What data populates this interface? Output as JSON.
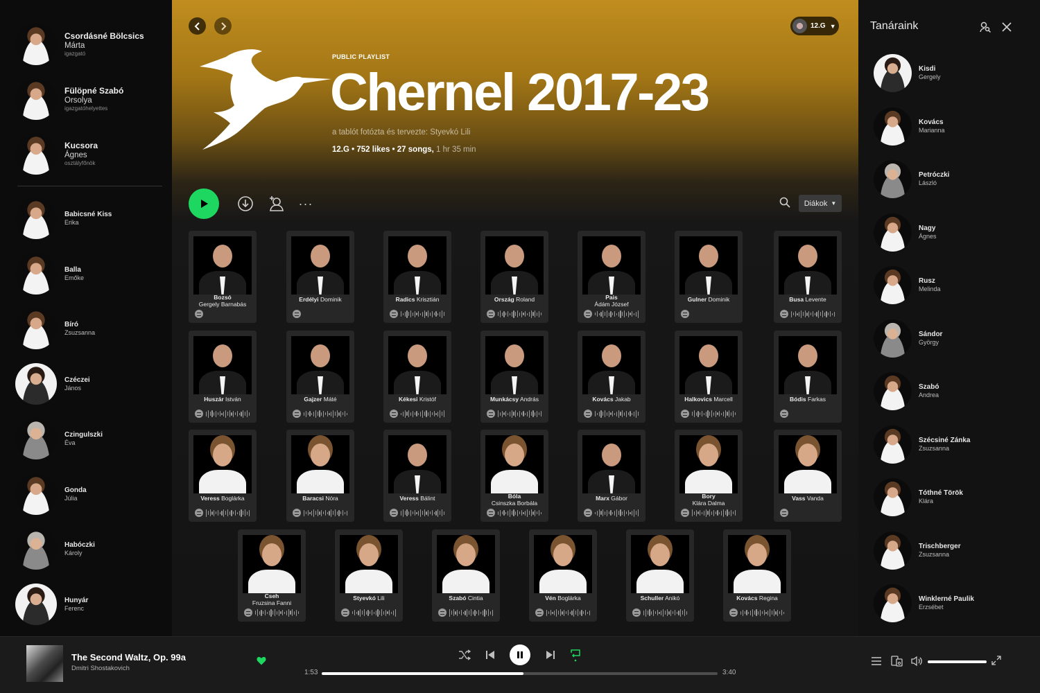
{
  "leftSidebar": {
    "staff": [
      {
        "surname": "Csordásné Bölcsics",
        "given": "Márta",
        "role": "igazgató"
      },
      {
        "surname": "Fülöpné Szabó",
        "given": "Orsolya",
        "role": "igazgatóhelyettes"
      },
      {
        "surname": "Kucsora",
        "given": "Ágnes",
        "role": "osztályfőnök"
      }
    ],
    "teachers": [
      {
        "surname": "Babicsné Kiss",
        "given": "Erika"
      },
      {
        "surname": "Balla",
        "given": "Emőke"
      },
      {
        "surname": "Bíró",
        "given": "Zsuzsanna"
      },
      {
        "surname": "Czéczei",
        "given": "János"
      },
      {
        "surname": "Czingulszki",
        "given": "Éva"
      },
      {
        "surname": "Gonda",
        "given": "Júlia"
      },
      {
        "surname": "Habóczki",
        "given": "Károly"
      },
      {
        "surname": "Hunyár",
        "given": "Ferenc"
      }
    ]
  },
  "header": {
    "user_label": "12.G",
    "back_icon": "chevron-left-icon",
    "forward_icon": "chevron-right-icon"
  },
  "playlist": {
    "type": "PUBLIC PLAYLIST",
    "title": "Chernel 2017-23",
    "description": "a tablót fotózta és tervezte: Styevkó Lili",
    "owner": "12.G",
    "likes": "752 likes",
    "songs": "27 songs,",
    "duration": "1 hr 35 min"
  },
  "actions": {
    "sort_label": "Diákok"
  },
  "students": [
    {
      "surname": "Bozsó",
      "given": "Gergely Barnabás",
      "two": true,
      "code": false,
      "girl": false
    },
    {
      "surname": "Erdélyi",
      "given": "Dominik",
      "two": false,
      "code": false,
      "girl": false
    },
    {
      "surname": "Radics",
      "given": "Krisztián",
      "two": false,
      "code": true,
      "girl": false
    },
    {
      "surname": "Ország",
      "given": "Roland",
      "two": false,
      "code": true,
      "girl": false
    },
    {
      "surname": "Pais",
      "given": "Ádám József",
      "two": true,
      "code": true,
      "girl": false
    },
    {
      "surname": "Gulner",
      "given": "Dominik",
      "two": false,
      "code": false,
      "girl": false
    },
    {
      "surname": "Busa",
      "given": "Levente",
      "two": false,
      "code": true,
      "girl": false
    },
    {
      "surname": "Huszár",
      "given": "István",
      "two": false,
      "code": true,
      "girl": false
    },
    {
      "surname": "Gajzer",
      "given": "Máté",
      "two": false,
      "code": true,
      "girl": false
    },
    {
      "surname": "Kékesi",
      "given": "Kristóf",
      "two": false,
      "code": true,
      "girl": false
    },
    {
      "surname": "Munkácsy",
      "given": "András",
      "two": false,
      "code": true,
      "girl": false
    },
    {
      "surname": "Kovács",
      "given": "Jakab",
      "two": false,
      "code": true,
      "girl": false
    },
    {
      "surname": "Halkovics",
      "given": "Marcell",
      "two": false,
      "code": true,
      "girl": false
    },
    {
      "surname": "Bódis",
      "given": "Farkas",
      "two": false,
      "code": false,
      "girl": false
    },
    {
      "surname": "Veress",
      "given": "Boglárka",
      "two": false,
      "code": true,
      "girl": true
    },
    {
      "surname": "Baracsi",
      "given": "Nóra",
      "two": false,
      "code": true,
      "girl": true
    },
    {
      "surname": "Veress",
      "given": "Bálint",
      "two": false,
      "code": true,
      "girl": false
    },
    {
      "surname": "Bóla",
      "given": "Csinszka Borbála",
      "two": true,
      "code": true,
      "girl": true
    },
    {
      "surname": "Marx",
      "given": "Gábor",
      "two": false,
      "code": true,
      "girl": false
    },
    {
      "surname": "Bory",
      "given": "Klára Dalma",
      "two": true,
      "code": true,
      "girl": true
    },
    {
      "surname": "Vass",
      "given": "Vanda",
      "two": false,
      "code": false,
      "girl": true
    },
    {
      "surname": "Cseh",
      "given": "Fruzsina Fanni",
      "two": true,
      "code": true,
      "girl": true
    },
    {
      "surname": "Styevkó",
      "given": "Lili",
      "two": false,
      "code": true,
      "girl": true
    },
    {
      "surname": "Szabó",
      "given": "Cintia",
      "two": false,
      "code": true,
      "girl": true
    },
    {
      "surname": "Vén",
      "given": "Boglárka",
      "two": false,
      "code": true,
      "girl": true
    },
    {
      "surname": "Schuller",
      "given": "Anikó",
      "two": false,
      "code": true,
      "girl": true
    },
    {
      "surname": "Kovács",
      "given": "Regina",
      "two": false,
      "code": true,
      "girl": true
    }
  ],
  "rightSidebar": {
    "title": "Tanáraink",
    "teachers": [
      {
        "surname": "Kisdi",
        "given": "Gergely"
      },
      {
        "surname": "Kovács",
        "given": "Marianna"
      },
      {
        "surname": "Petróczki",
        "given": "László"
      },
      {
        "surname": "Nagy",
        "given": "Ágnes"
      },
      {
        "surname": "Rusz",
        "given": "Melinda"
      },
      {
        "surname": "Sándor",
        "given": "György"
      },
      {
        "surname": "Szabó",
        "given": "Andrea"
      },
      {
        "surname": "Szécsiné Zánka",
        "given": "Zsuzsanna"
      },
      {
        "surname": "Tóthné Török",
        "given": "Klára"
      },
      {
        "surname": "Trischberger",
        "given": "Zsuzsanna"
      },
      {
        "surname": "Winklerné Paulik",
        "given": "Erzsébet"
      }
    ]
  },
  "player": {
    "song_title": "The Second Waltz, Op. 99a",
    "artist": "Dmitri Shostakovich",
    "time_current": "1:53",
    "time_total": "3:40",
    "progress": 0.51,
    "volume": 1.0,
    "liked": true,
    "accent": "#1ed760"
  }
}
